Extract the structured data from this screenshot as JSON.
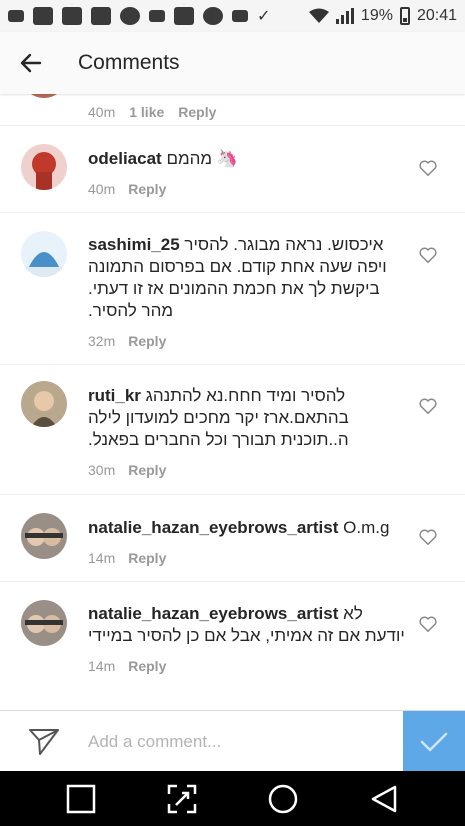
{
  "status": {
    "battery": "19%",
    "time": "20:41",
    "left_icons": [
      "message-icon",
      "facebook-icon",
      "facebook-icon",
      "app-icon",
      "game-icon",
      "app-icon",
      "flipboard-icon",
      "app-icon",
      "voicemail-icon",
      "check-icon"
    ]
  },
  "header": {
    "title": "Comments"
  },
  "partial_comment": {
    "time": "40m",
    "likes": "1 like",
    "reply": "Reply"
  },
  "comments": [
    {
      "username": "odeliacat",
      "text": "מהמם 🦄",
      "time": "40m",
      "reply": "Reply",
      "avatar_color": "#c0392b"
    },
    {
      "username": "sashimi_25",
      "text": "איכסוש. נראה מבוגר. להסיר ויפה שעה אחת קודם. אם בפרסום התמונה ביקשת לך את חכמת ההמונים אז זו דעתי. מהר להסיר.",
      "time": "32m",
      "reply": "Reply",
      "avatar_color": "#4a90c8"
    },
    {
      "username": "ruti_kr",
      "text": "להסיר ומיד חחח.נא להתנהג בהתאם.ארז יקר מחכים למועדון לילה ה..תוכנית תבורך וכל החברים בפאנל.",
      "time": "30m",
      "reply": "Reply",
      "avatar_color": "#8a7560"
    },
    {
      "username": "natalie_hazan_eyebrows_artist",
      "text": "O.m.g",
      "time": "14m",
      "reply": "Reply",
      "avatar_color": "#7b6f66"
    },
    {
      "username": "natalie_hazan_eyebrows_artist",
      "text": "לא יודעת אם זה אמיתי, אבל אם כן להסיר במיידי",
      "time": "14m",
      "reply": "Reply",
      "avatar_color": "#7b6f66"
    }
  ],
  "composer": {
    "placeholder": "Add a comment..."
  },
  "colors": {
    "accent": "#5fa8e8",
    "meta": "#999999"
  }
}
